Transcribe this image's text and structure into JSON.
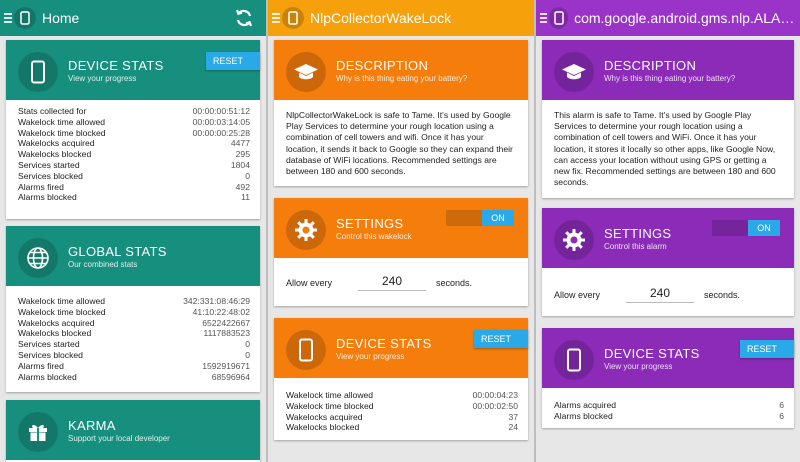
{
  "colors": {
    "teal": "#178f7e",
    "orange": "#f47d0c",
    "purple": "#8b2bb8",
    "accent_blue": "#29a9e8"
  },
  "home": {
    "title": "Home",
    "device_stats": {
      "title": "DEVICE STATS",
      "subtitle": "View your progress",
      "reset_label": "RESET",
      "rows": [
        {
          "label": "Stats collected for",
          "value": "00:00:00:51:12"
        },
        {
          "label": "Wakelock time allowed",
          "value": "00:00:03:14:05"
        },
        {
          "label": "Wakelock time blocked",
          "value": "00:00:00:25:28"
        },
        {
          "label": "Wakelocks acquired",
          "value": "4477"
        },
        {
          "label": "Wakelocks blocked",
          "value": "295"
        },
        {
          "label": "Services started",
          "value": "1804"
        },
        {
          "label": "Services blocked",
          "value": "0"
        },
        {
          "label": "Alarms fired",
          "value": "492"
        },
        {
          "label": "Alarms blocked",
          "value": "11"
        }
      ]
    },
    "global_stats": {
      "title": "GLOBAL STATS",
      "subtitle": "Our combined stats",
      "rows": [
        {
          "label": "Wakelock time allowed",
          "value": "342:331:08:46:29"
        },
        {
          "label": "Wakelock time blocked",
          "value": "41:10:22:48:02"
        },
        {
          "label": "Wakelocks acquired",
          "value": "6522422667"
        },
        {
          "label": "Wakelocks blocked",
          "value": "1117883523"
        },
        {
          "label": "Services started",
          "value": "0"
        },
        {
          "label": "Services blocked",
          "value": "0"
        },
        {
          "label": "Alarms fired",
          "value": "1592919671"
        },
        {
          "label": "Alarms blocked",
          "value": "68596964"
        }
      ]
    },
    "karma": {
      "title": "KARMA",
      "subtitle": "Support your local developer"
    }
  },
  "wakelock": {
    "title": "NlpCollectorWakeLock",
    "description": {
      "title": "DESCRIPTION",
      "subtitle": "Why is this thing eating your battery?",
      "text": "NlpCollectorWakeLock is safe to Tame. It's used by Google Play Services to determine your rough location using a combination of cell towers and wifi. Once it has your location, it sends it back to Google so they can expand their database of WiFi locations. Recommended settings are between 180 and 600 seconds."
    },
    "settings": {
      "title": "SETTINGS",
      "subtitle": "Control this wakelock",
      "toggle_label": "ON",
      "allow_label": "Allow every",
      "allow_value": "240",
      "unit_label": "seconds."
    },
    "device_stats": {
      "title": "DEVICE STATS",
      "subtitle": "View your progress",
      "reset_label": "RESET",
      "rows": [
        {
          "label": "Wakelock time allowed",
          "value": "00:00:04:23"
        },
        {
          "label": "Wakelock time blocked",
          "value": "00:00:02:50"
        },
        {
          "label": "Wakelocks acquired",
          "value": "37"
        },
        {
          "label": "Wakelocks blocked",
          "value": "24"
        }
      ]
    }
  },
  "alarm": {
    "title": "com.google.android.gms.nlp.ALARM_W...",
    "description": {
      "title": "DESCRIPTION",
      "subtitle": "Why is this thing eating your battery?",
      "text": "This alarm is safe to Tame. It's used by Google Play Services to determine your rough location using a combination of cell towers and WiFi. Once it has your location, it stores it locally so other apps, like Google Now, can access your location without using GPS or getting a new fix. Recommended settings are between 180 and 600 seconds."
    },
    "settings": {
      "title": "SETTINGS",
      "subtitle": "Control this alarm",
      "toggle_label": "ON",
      "allow_label": "Allow every",
      "allow_value": "240",
      "unit_label": "seconds."
    },
    "device_stats": {
      "title": "DEVICE STATS",
      "subtitle": "View your progress",
      "reset_label": "RESET",
      "rows": [
        {
          "label": "Alarms acquired",
          "value": "6"
        },
        {
          "label": "Alarms blocked",
          "value": "6"
        }
      ]
    }
  }
}
